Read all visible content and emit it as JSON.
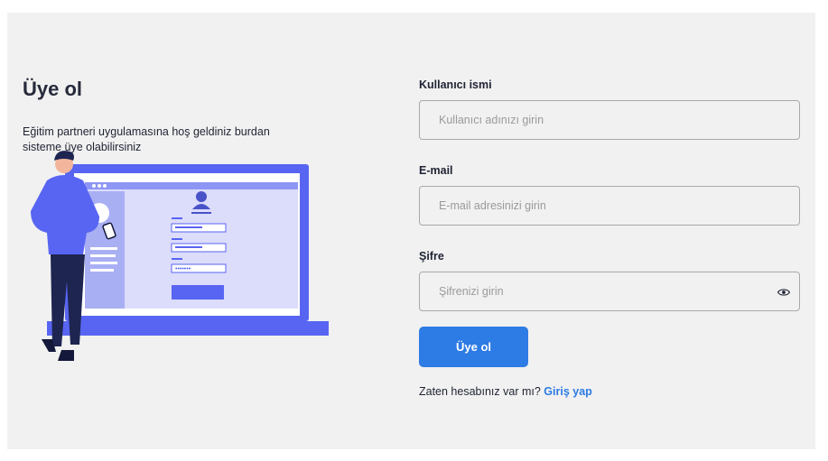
{
  "page": {
    "title": "Üye ol",
    "description": "Eğitim partneri uygulamasına hoş geldiniz burdan sisteme üye olabilirsiniz"
  },
  "form": {
    "username": {
      "label": "Kullanıcı ismi",
      "placeholder": "Kullanıcı adınızı girin",
      "value": ""
    },
    "email": {
      "label": "E-mail",
      "placeholder": "E-mail adresinizi girin",
      "value": ""
    },
    "password": {
      "label": "Şifre",
      "placeholder": "Şifrenizi girin",
      "value": "",
      "toggle_icon": "eye-icon"
    },
    "submit_label": "Üye ol"
  },
  "footer": {
    "prompt": "Zaten hesabınız var mı?",
    "login_link": "Giriş yap"
  },
  "colors": {
    "primary": "#2d7be4",
    "illustration_blue": "#5865f2",
    "illustration_light": "#dcdcfb",
    "background": "#f1f1f1"
  }
}
